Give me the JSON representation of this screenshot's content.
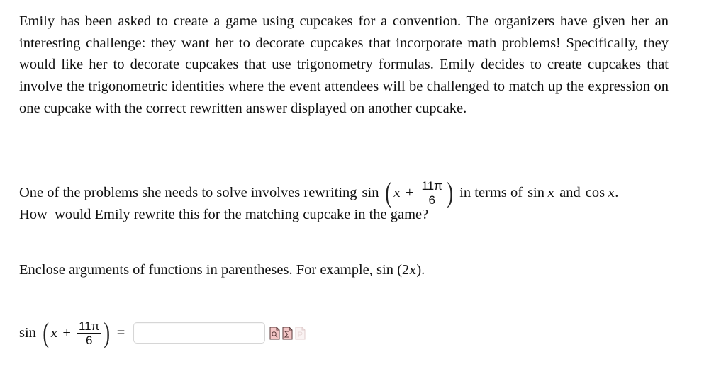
{
  "problem": {
    "paragraph1": "Emily has been asked to create a game using cupcakes for a convention. The organizers have given her an interesting challenge: they want her to decorate cupcakes that incorporate math problems! Specifically, they would like her to decorate cupcakes that use trigonometry formulas. Emily decides to create cupcakes that involve the trigonometric identities where the event attendees will be challenged to match up the expression on one cupcake with the correct rewritten answer displayed on another cupcake.",
    "question_prefix": "One of the problems she needs to solve involves rewriting",
    "question_suffix_1": "in terms of",
    "question_and": "and",
    "question_end": ".",
    "question_line2": "How  would Emily rewrite this for the matching cupcake in the game?",
    "instruction_prefix": "Enclose arguments of functions in parentheses. For example,",
    "instruction_example": "sin (2x)",
    "instruction_end": "."
  },
  "expression": {
    "func": "sin",
    "var": "x",
    "plus": "+",
    "numerator": "11π",
    "denominator": "6",
    "open_paren": "(",
    "close_paren": ")",
    "equals": "=",
    "sin_x": "sin",
    "cos_x": "cos"
  },
  "answer": {
    "value": "",
    "placeholder": ""
  },
  "tools": [
    {
      "name": "preview-icon",
      "label": "Preview"
    },
    {
      "name": "equation-editor-icon",
      "label": "Equation Editor"
    },
    {
      "name": "help-icon",
      "label": "P"
    }
  ],
  "colors": {
    "icon_fill": "#f4c7c7",
    "icon_stroke": "#5a3a3a",
    "icon_disabled": "#e6d6d6",
    "input_border": "#d6d6d6"
  }
}
